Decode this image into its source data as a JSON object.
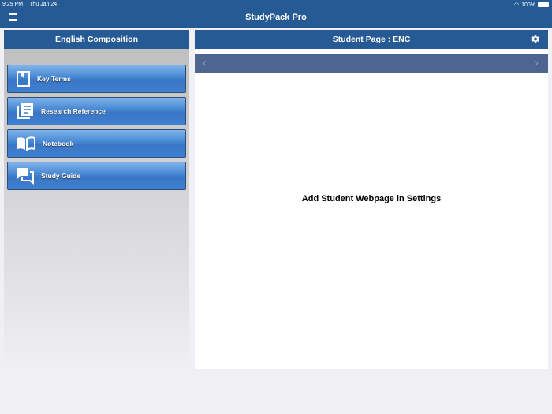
{
  "status": {
    "time": "9:29 PM",
    "date": "Thu Jan 24",
    "battery": "100%"
  },
  "app": {
    "title": "StudyPack Pro"
  },
  "left": {
    "title": "English Composition",
    "items": [
      {
        "label": "Key Terms",
        "icon": "bookmark-book-icon"
      },
      {
        "label": "Research Reference",
        "icon": "document-stack-icon"
      },
      {
        "label": "Notebook",
        "icon": "open-book-icon"
      },
      {
        "label": "Study Guide",
        "icon": "chat-bubbles-icon"
      }
    ]
  },
  "right": {
    "title": "Student Page : ENC",
    "message": "Add Student Webpage in Settings",
    "back": "‹",
    "forward": "›"
  }
}
